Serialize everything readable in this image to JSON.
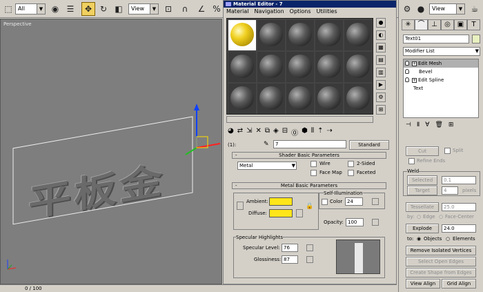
{
  "toolbar": {
    "selection_filter": "All",
    "coord_system": "View",
    "icons": [
      "select-icon",
      "select-region-icon",
      "select-filter-icon",
      "move-icon",
      "rotate-icon",
      "scale-icon",
      "coord-icon",
      "snap-icon",
      "angle-snap-icon",
      "percent-snap-icon"
    ],
    "right_coord": "View"
  },
  "viewport": {
    "label": "Perspective",
    "text3d": "平板金"
  },
  "material_editor": {
    "title": "Material Editor - 7",
    "menu": [
      "Material",
      "Navigation",
      "Options",
      "Utilities"
    ],
    "slot_label": "(1):",
    "name": "7",
    "type_button": "Standard",
    "shader_rollout": "Shader Basic Parameters",
    "shader": "Metal",
    "wire": "Wire",
    "two_sided": "2-Sided",
    "face_map": "Face Map",
    "faceted": "Faceted",
    "metal_rollout": "Metal Basic Parameters",
    "self_illum_group": "Self-Illumination",
    "color_label": "Color",
    "color_value": "24",
    "ambient": "Ambient:",
    "diffuse": "Diffuse:",
    "opacity_label": "Opacity:",
    "opacity_value": "100",
    "specular_group": "Specular Highlights",
    "spec_level_label": "Specular Level:",
    "spec_level_value": "76",
    "gloss_label": "Glossiness:",
    "gloss_value": "87",
    "swatch_color": "#ffe61a"
  },
  "command_panel": {
    "object_name": "Text01",
    "modifier_list": "Modifier List",
    "stack": [
      {
        "label": "Edit Mesh",
        "expand": "+",
        "selected": true
      },
      {
        "label": "Bevel",
        "expand": "",
        "selected": false
      },
      {
        "label": "Edit Spline",
        "expand": "+",
        "selected": false
      },
      {
        "label": "Text",
        "expand": "",
        "selected": false
      }
    ],
    "cut": "Cut",
    "split": "Split",
    "refine_ends": "Refine Ends",
    "weld_group": "Weld",
    "selected_btn": "Selected",
    "selected_val": "0.1",
    "target_btn": "Target",
    "target_val": "4",
    "pixels": "pixels",
    "tessellate": "Tessellate",
    "tessellate_val": "25.0",
    "by_label": "by:",
    "edge": "Edge",
    "face_center": "Face-Center",
    "explode": "Explode",
    "explode_val": "24.0",
    "to_label": "to:",
    "objects": "Objects",
    "elements": "Elements",
    "remove_isolated": "Remove Isolated Vertices",
    "select_open_edges": "Select Open Edges",
    "create_shape": "Create Shape from Edges",
    "view_align": "View Align",
    "grid_align": "Grid Align"
  },
  "status": {
    "frame": "0 / 100"
  }
}
